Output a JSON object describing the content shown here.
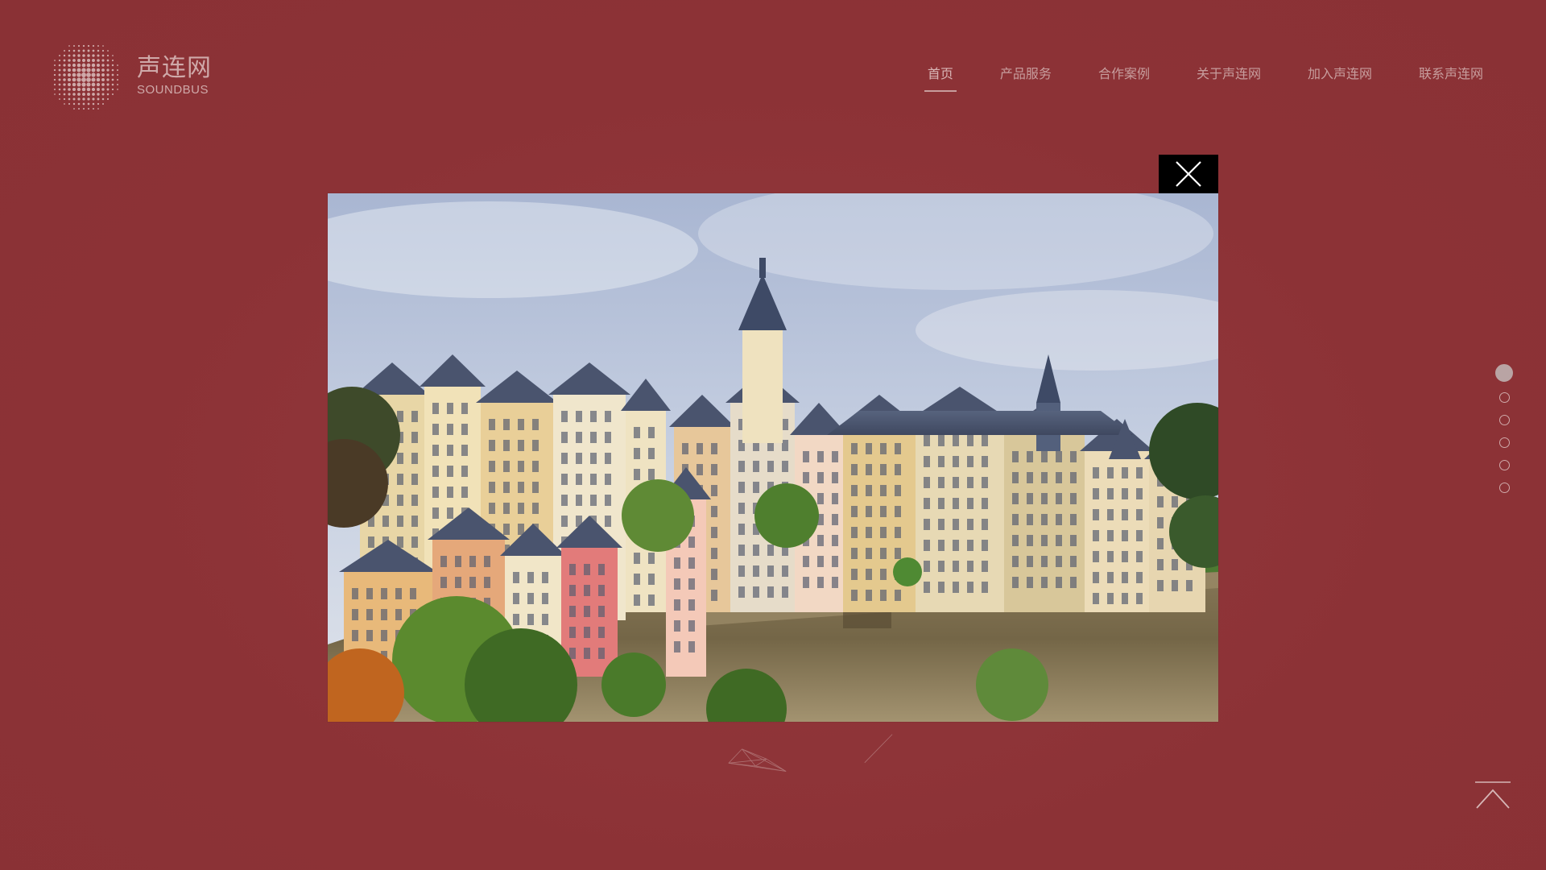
{
  "brand": {
    "name_cn": "声连网",
    "name_en": "SOUNDBUS"
  },
  "nav": {
    "items": [
      {
        "label": "首页",
        "active": true
      },
      {
        "label": "产品服务",
        "active": false
      },
      {
        "label": "合作案例",
        "active": false
      },
      {
        "label": "关于声连网",
        "active": false
      },
      {
        "label": "加入声连网",
        "active": false
      },
      {
        "label": "联系声连网",
        "active": false
      }
    ]
  },
  "pager": {
    "count": 6,
    "active_index": 0
  },
  "colors": {
    "background": "#8e3438",
    "nav_text": "#c79d9d",
    "close_button_bg": "#000000"
  },
  "icons": {
    "close": "close-icon",
    "back_to_top": "chevron-up-icon",
    "logo": "dotted-globe-logo-icon"
  }
}
